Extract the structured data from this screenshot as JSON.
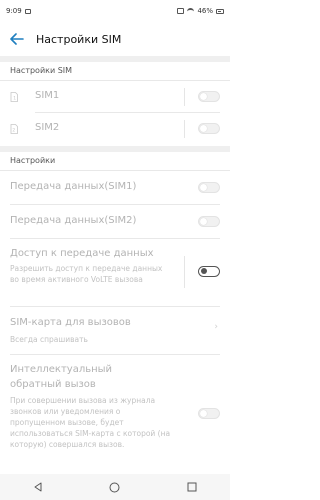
{
  "status_bar": {
    "time": "9:09",
    "battery_percent": "46%",
    "icons": [
      "gallery-icon",
      "vibrate-icon",
      "wifi-icon",
      "battery-icon"
    ]
  },
  "header": {
    "title": "Настройки SIM",
    "back_icon": "arrow-left-icon"
  },
  "sections": {
    "sim": {
      "header": "Настройки SIM",
      "items": [
        {
          "label": "SIM1",
          "icon": "sim-card-icon",
          "toggle": "off"
        },
        {
          "label": "SIM2",
          "icon": "sim-card-icon",
          "toggle": "off"
        }
      ]
    },
    "settings": {
      "header": "Настройки",
      "data_sim1": {
        "label": "Передача данных(SIM1)",
        "toggle": "off"
      },
      "data_sim2": {
        "label": "Передача данных(SIM2)",
        "toggle": "off"
      },
      "data_access": {
        "label": "Доступ к передаче данных",
        "description": "Разрешить доступ к передаче данных во время активного VoLTE вызова",
        "toggle": "off"
      },
      "call_sim": {
        "label": "SIM-карта для вызовов",
        "value": "Всегда спрашивать"
      },
      "smart_callback": {
        "label": "Интеллектуальный обратный вызов",
        "description": "При совершении вызова из журнала звонков или уведомления о пропущенном вызове, будет использоваться SIM-карта с которой (на которую) совершался вызов.",
        "toggle": "off"
      }
    }
  },
  "nav_bar": {
    "icons": [
      "back-triangle-icon",
      "home-circle-icon",
      "recents-square-icon"
    ]
  }
}
